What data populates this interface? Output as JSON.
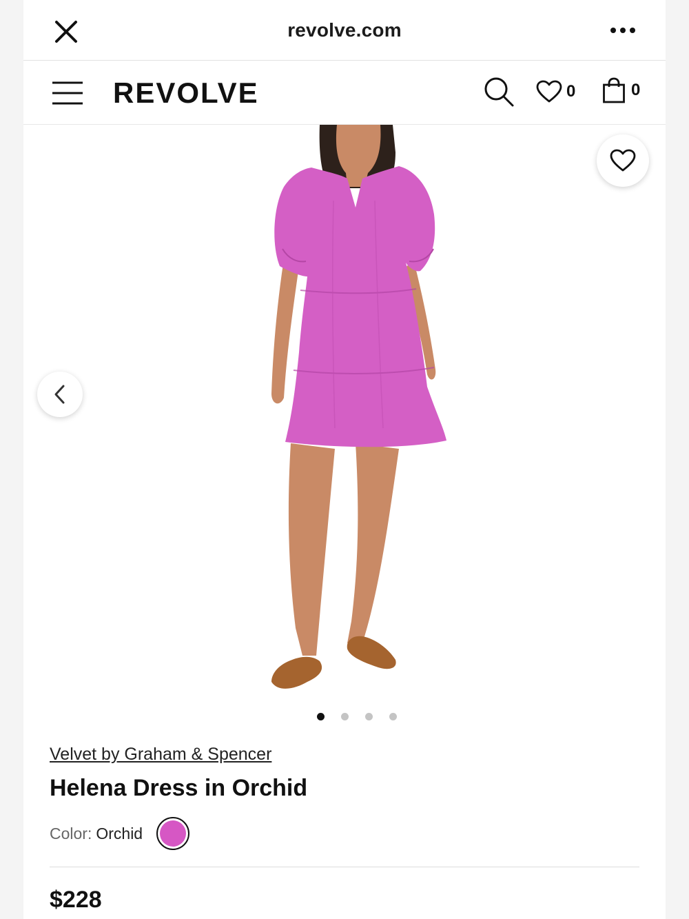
{
  "browser": {
    "url": "revolve.com",
    "close_icon": "close-icon",
    "more_icon": "more-options-icon"
  },
  "header": {
    "logo": "REVOLVE",
    "menu_icon": "hamburger-menu-icon",
    "search_icon": "search-icon",
    "wishlist_icon": "heart-icon",
    "wishlist_count": "0",
    "bag_icon": "shopping-bag-icon",
    "bag_count": "0"
  },
  "gallery": {
    "favorite_icon": "heart-icon",
    "prev_icon": "chevron-left-icon",
    "image_count": 4,
    "active_image": 1
  },
  "product": {
    "brand": "Velvet by Graham & Spencer",
    "name": "Helena Dress in Orchid",
    "color_label": "Color:",
    "color_value": "Orchid",
    "swatch_color": "#d657c4",
    "price": "$228"
  },
  "colors": {
    "dress": "#d45fc5",
    "skin": "#c98a66",
    "hair": "#2d211b",
    "sandal": "#a5642f"
  }
}
